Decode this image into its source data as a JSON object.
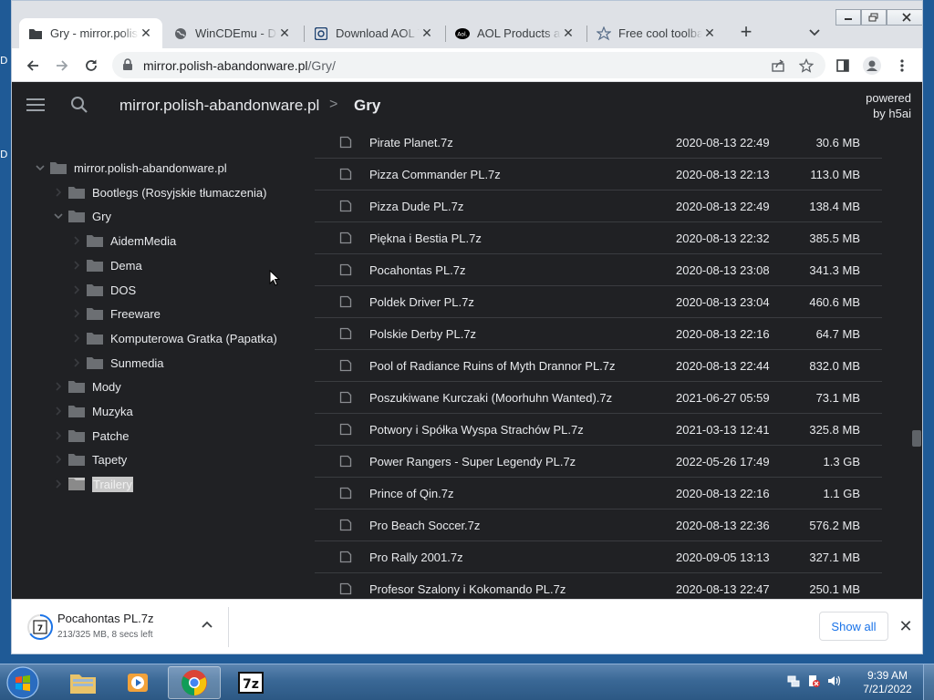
{
  "desktop": {
    "frag1": "D",
    "frag2": "D"
  },
  "tabs": [
    {
      "title": "Gry - mirror.polish-abandonware.pl",
      "favicon": "folder-icon"
    },
    {
      "title": "WinCDEmu - Download",
      "favicon": "globe-icon"
    },
    {
      "title": "Download AOL Toolbar",
      "favicon": "download-site-icon"
    },
    {
      "title": "AOL Products and Services",
      "favicon": "aol-icon"
    },
    {
      "title": "Free cool toolbar",
      "favicon": "star-icon"
    }
  ],
  "tab_close": "✕",
  "new_tab": "+",
  "window_controls": {
    "minimize": "▭",
    "maximize": "□",
    "close": "✕"
  },
  "omnibox": {
    "host": "mirror.polish-abandonware.pl",
    "path": "/Gry/"
  },
  "header": {
    "crumb_root": "mirror.polish-abandonware.pl",
    "crumb_sep": ">",
    "crumb_current": "Gry",
    "powered_line1": "powered",
    "powered_line2": "by h5ai"
  },
  "tree": [
    {
      "label": "mirror.polish-abandonware.pl",
      "level": 0,
      "expanded": true
    },
    {
      "label": "Bootlegs (Rosyjskie tłumaczenia)",
      "level": 1,
      "expanded": false
    },
    {
      "label": "Gry",
      "level": 1,
      "expanded": true
    },
    {
      "label": "AidemMedia",
      "level": 2,
      "expanded": false
    },
    {
      "label": "Dema",
      "level": 2,
      "expanded": false
    },
    {
      "label": "DOS",
      "level": 2,
      "expanded": false
    },
    {
      "label": "Freeware",
      "level": 2,
      "expanded": false
    },
    {
      "label": "Komputerowa Gratka (Papatka)",
      "level": 2,
      "expanded": false
    },
    {
      "label": "Sunmedia",
      "level": 2,
      "expanded": false
    },
    {
      "label": "Mody",
      "level": 1,
      "expanded": false
    },
    {
      "label": "Muzyka",
      "level": 1,
      "expanded": false
    },
    {
      "label": "Patche",
      "level": 1,
      "expanded": false
    },
    {
      "label": "Tapety",
      "level": 1,
      "expanded": false
    },
    {
      "label": "Trailery",
      "level": 1,
      "expanded": false,
      "selected": true
    }
  ],
  "files": [
    {
      "name": "Pirate Planet.7z",
      "date": "2020-08-13 22:49",
      "size": "30.6 MB"
    },
    {
      "name": "Pizza Commander PL.7z",
      "date": "2020-08-13 22:13",
      "size": "113.0 MB"
    },
    {
      "name": "Pizza Dude PL.7z",
      "date": "2020-08-13 22:49",
      "size": "138.4 MB"
    },
    {
      "name": "Piękna i Bestia PL.7z",
      "date": "2020-08-13 22:32",
      "size": "385.5 MB"
    },
    {
      "name": "Pocahontas PL.7z",
      "date": "2020-08-13 23:08",
      "size": "341.3 MB"
    },
    {
      "name": "Poldek Driver PL.7z",
      "date": "2020-08-13 23:04",
      "size": "460.6 MB"
    },
    {
      "name": "Polskie Derby PL.7z",
      "date": "2020-08-13 22:16",
      "size": "64.7 MB"
    },
    {
      "name": "Pool of Radiance Ruins of Myth Drannor PL.7z",
      "date": "2020-08-13 22:44",
      "size": "832.0 MB"
    },
    {
      "name": "Poszukiwane Kurczaki (Moorhuhn Wanted).7z",
      "date": "2021-06-27 05:59",
      "size": "73.1 MB"
    },
    {
      "name": "Potwory i Spółka Wyspa Strachów PL.7z",
      "date": "2021-03-13 12:41",
      "size": "325.8 MB"
    },
    {
      "name": "Power Rangers - Super Legendy PL.7z",
      "date": "2022-05-26 17:49",
      "size": "1.3 GB"
    },
    {
      "name": "Prince of Qin.7z",
      "date": "2020-08-13 22:16",
      "size": "1.1 GB"
    },
    {
      "name": "Pro Beach Soccer.7z",
      "date": "2020-08-13 22:36",
      "size": "576.2 MB"
    },
    {
      "name": "Pro Rally 2001.7z",
      "date": "2020-09-05 13:13",
      "size": "327.1 MB"
    },
    {
      "name": "Profesor Szalony i Kokomando PL.7z",
      "date": "2020-08-13 22:47",
      "size": "250.1 MB"
    }
  ],
  "download": {
    "filename": "Pocahontas PL.7z",
    "status": "213/325 MB, 8 secs left",
    "progress_fraction": 0.655,
    "show_all": "Show all",
    "close": "✕"
  },
  "taskbar": {
    "apps": [
      "explorer-icon",
      "media-player-icon",
      "chrome-icon",
      "7zip-icon"
    ],
    "active_app": "chrome-icon",
    "time": "9:39 AM",
    "date": "7/21/2022"
  },
  "colors": {
    "page_bg": "#202124",
    "text": "#e8eaed",
    "accent_link": "#1a73e8",
    "selection": "#c8c8c8"
  }
}
